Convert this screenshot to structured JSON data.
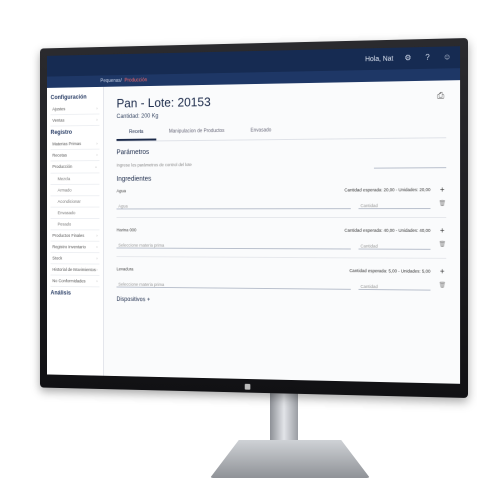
{
  "topbar": {
    "user_label": "Hola, Nat"
  },
  "breadcrumb": {
    "home": "Pequenas",
    "current": "Producción"
  },
  "sidebar": {
    "sections": [
      {
        "heading": "Configuración",
        "items": [
          "Ajustes",
          "Ventas"
        ]
      },
      {
        "heading": "Registro",
        "items": [
          "Materias Primas",
          "Recetas",
          "Producción",
          "Mezcla",
          "Armado",
          "Acondicionar",
          "Envasado",
          "Pesado",
          "Productos Finales",
          "Registro Inventario",
          "Stock",
          "Historial de Movimientos",
          "No Conformidades"
        ]
      },
      {
        "heading": "Análisis",
        "items": []
      }
    ]
  },
  "page": {
    "title": "Pan - Lote: 20153",
    "subtitle": "Cantidad: 200 Kg",
    "tabs": [
      "Receta",
      "Manipulacion de Productos",
      "Envasado"
    ],
    "parameters_title": "Parámetros",
    "parameters_hint": "Ingrese los parámetros de control del lote",
    "parameter_value": "",
    "ingredients_title": "Ingredientes",
    "ingredients": [
      {
        "name": "Agua",
        "availability": "Cantidad esperada: 20,00 - Unidades: 20,00",
        "sub_label": "Agua",
        "qty_placeholder": "Cantidad"
      },
      {
        "name": "Harina 000",
        "availability": "Cantidad esperada: 40,00 - Unidades: 40,00",
        "sub_label": "Seleccione materia prima",
        "qty_placeholder": "Cantidad"
      },
      {
        "name": "Levadura",
        "availability": "Cantidad esperada: 5,00 - Unidades: 5,00",
        "sub_label": "Seleccione materia prima",
        "qty_placeholder": "Cantidad"
      }
    ],
    "devices_title": "Dispositivos"
  }
}
